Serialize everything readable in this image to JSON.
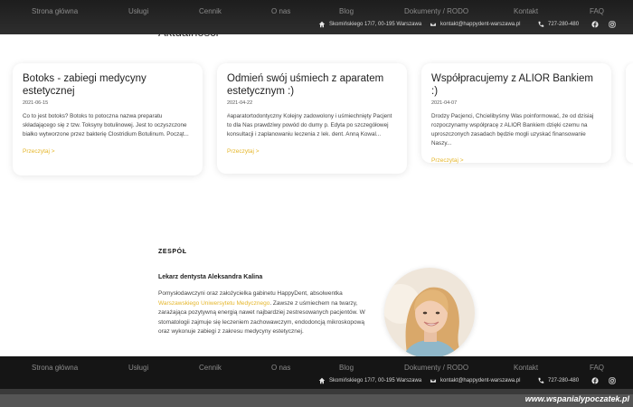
{
  "nav": {
    "items": [
      "Strona główna",
      "Usługi",
      "Cennik",
      "O nas",
      "Blog",
      "Dokumenty / RODO",
      "Kontakt",
      "FAQ"
    ]
  },
  "contact": {
    "address": "Skomińskiego 17/7, 00-195 Warszawa",
    "email": "kontakt@happydent-warszawa.pl",
    "phone": "727-280-480"
  },
  "section_title": "Aktualności",
  "posts": [
    {
      "title": "Botoks - zabiegi medycyny estetycznej",
      "date": "2021-06-15",
      "excerpt": "Co to jest botoks? Botoks to potoczna nazwa preparatu składającego się z tzw. Toksyny botulinowej. Jest to oczyszczone białko wytworzone przez bakterię Clostridium Botulinum. Począt...",
      "more": "Przeczytaj >"
    },
    {
      "title": "Odmień swój uśmiech z aparatem estetycznym :)",
      "date": "2021-04-22",
      "excerpt": "#aparatortodontyczny Kolejny zadowolony i uśmiechnięty Pacjent to dla Nas prawdziwy powód do dumy p. Edyta po szczegółowej konsultacji i zaplanowaniu leczenia z lek. dent. Anną Kowal...",
      "more": "Przeczytaj >"
    },
    {
      "title": "Współpracujemy z ALIOR Bankiem :)",
      "date": "2021-04-07",
      "excerpt": "Drodzy Pacjenci, Chcielibyśmy Was poinformować, że od dzisiaj rozpoczynamy współpracę z ALIOR Bankiem dzięki czemu na uproszczonych zasadach będzie mogli uzyskać finansowanie Naszy...",
      "more": "Przeczytaj >"
    }
  ],
  "team": {
    "label": "ZESPÓŁ",
    "member_name": "Lekarz dentysta Aleksandra Kalina",
    "bio_before": "Pomysłodawczyni oraz założycielka gabinetu HappyDent, absolwentka ",
    "bio_link": "Warszawskiego Uniwersytetu Medycznego",
    "bio_after": ". Zawsze z uśmiechem na twarzy, zarażająca pozytywną energią nawet najbardziej zestresowanych pacjentów. W stomatologii zajmuje się leczeniem zachowawczym, endodoncją mikroskopową oraz wykonuje zabiegi z zakresu medycyny estetycznej."
  },
  "watermark": "www.wspanialypoczatek.pl",
  "colors": {
    "accent": "#e5b62a",
    "nav_bg": "#1d1d1d"
  }
}
